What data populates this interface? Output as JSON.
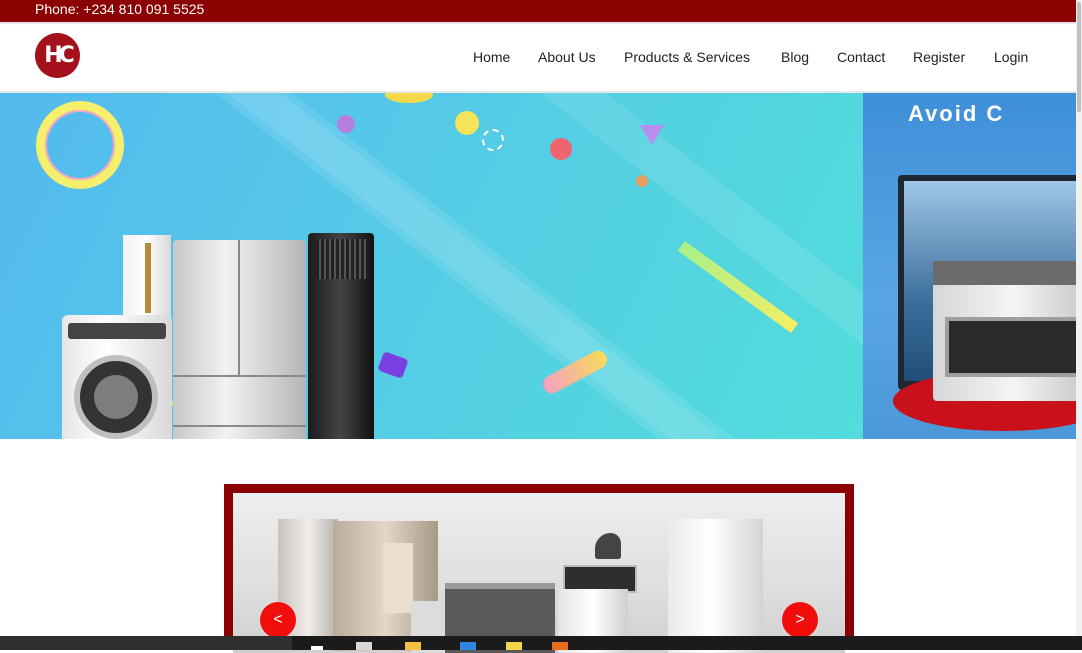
{
  "topbar": {
    "phone": "Phone: +234 810 091 5525"
  },
  "logo": {
    "text": "HC",
    "color": "#a4101c"
  },
  "nav": {
    "items": [
      "Home",
      "About Us",
      "Products & Services",
      "Blog",
      "Contact",
      "Register",
      "Login"
    ]
  },
  "hero": {
    "second_slide_text": "Avoid C"
  },
  "slider": {
    "prev_label": "<",
    "next_label": ">"
  },
  "colors": {
    "brand": "#8b0000",
    "arrow": "#f20d0d",
    "hero_bg": "#55c7ea"
  },
  "taskbar": {
    "icons": [
      "start-icon",
      "notepad-icon",
      "folder-icon",
      "edge-icon",
      "sticky-icon",
      "app-icon"
    ]
  }
}
